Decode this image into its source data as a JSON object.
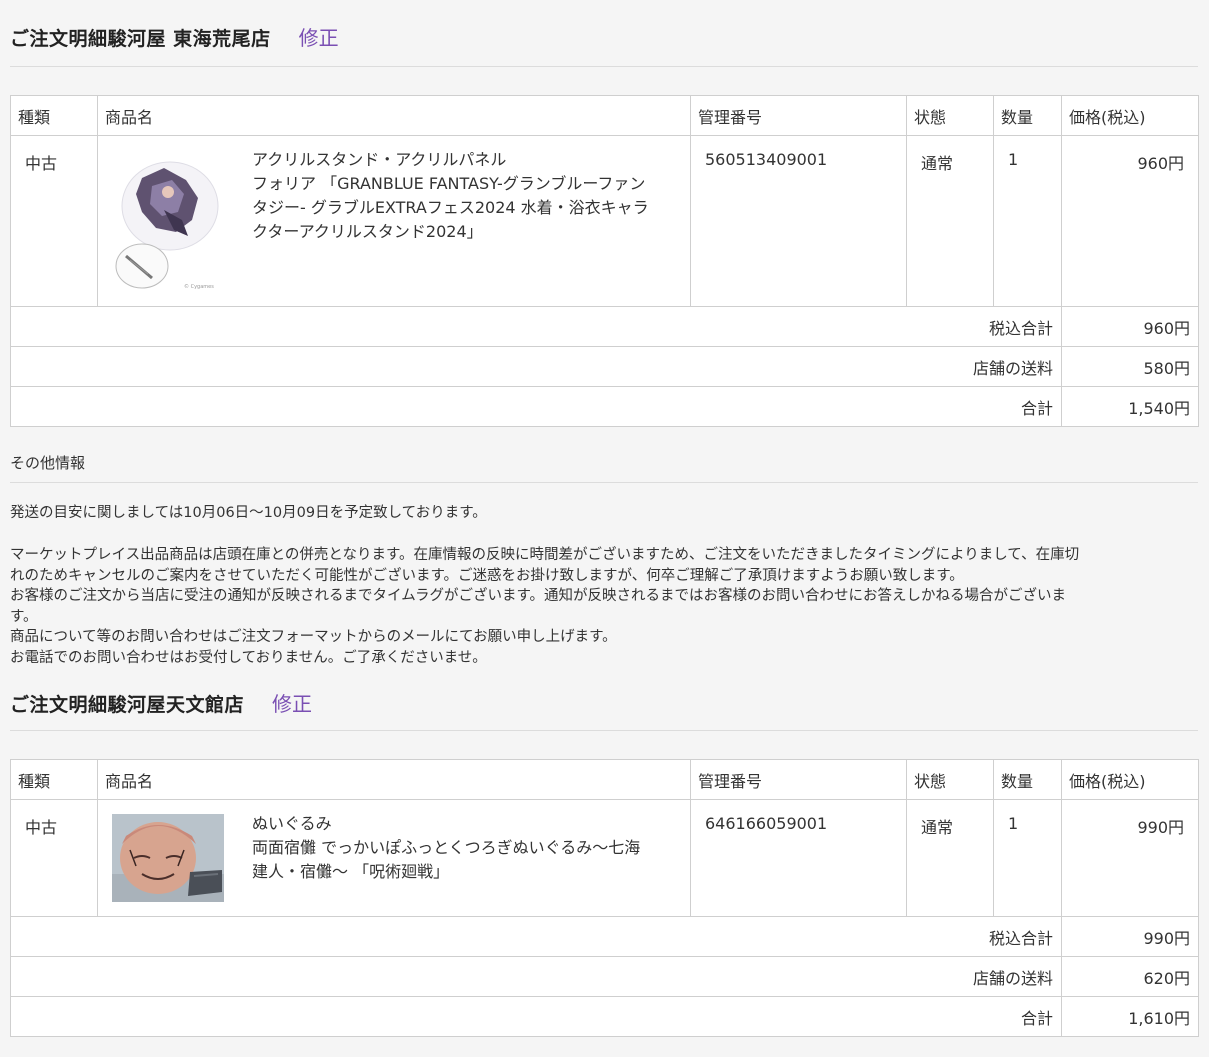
{
  "order1": {
    "title": "ご注文明細駿河屋 東海荒尾店",
    "edit_label": "修正",
    "headers": [
      "種類",
      "商品名",
      "管理番号",
      "状態",
      "数量",
      "価格(税込)"
    ],
    "item": {
      "type": "中古",
      "name_lines": [
        "アクリルスタンド・アクリルパネル",
        "フォリア 「GRANBLUE FANTASY-グランブルーファン",
        "タジー- グラブルEXTRAフェス2024 水着・浴衣キャラ",
        "クターアクリルスタンド2024」"
      ],
      "code": "560513409001",
      "condition": "通常",
      "qty": "1",
      "price": "960円"
    },
    "subtotal_label": "税込合計",
    "subtotal": "960円",
    "shipping_label": "店舗の送料",
    "shipping": "580円",
    "total_label": "合計",
    "total": "1,540円"
  },
  "other_info": {
    "title": "その他情報",
    "shipping_notice": "発送の目安に関しましては10月06日～10月09日を予定致しております。",
    "notice_lines": [
      "マーケットプレイス出品商品は店頭在庫との併売となります。在庫情報の反映に時間差がございますため、ご注文をいただきましたタイミングによりまして、在庫切",
      "れのためキャンセルのご案内をさせていただく可能性がございます。ご迷惑をお掛け致しますが、何卒ご理解ご了承頂けますようお願い致します。",
      "お客様のご注文から当店に受注の通知が反映されるまでタイムラグがございます。通知が反映されるまではお客様のお問い合わせにお答えしかねる場合がございま",
      "す。",
      "商品について等のお問い合わせはご注文フォーマットからのメールにてお願い申し上げます。",
      "お電話でのお問い合わせはお受付しておりません。ご了承くださいませ。"
    ]
  },
  "order2": {
    "title": "ご注文明細駿河屋天文館店",
    "edit_label": "修正",
    "headers": [
      "種類",
      "商品名",
      "管理番号",
      "状態",
      "数量",
      "価格(税込)"
    ],
    "item": {
      "type": "中古",
      "name_lines": [
        "ぬいぐるみ",
        "両面宿儺 でっかいぽふっとくつろぎぬいぐるみ～七海",
        "建人・宿儺～ 「呪術廻戦」"
      ],
      "code": "646166059001",
      "condition": "通常",
      "qty": "1",
      "price": "990円"
    },
    "subtotal_label": "税込合計",
    "subtotal": "990円",
    "shipping_label": "店舗の送料",
    "shipping": "620円",
    "total_label": "合計",
    "total": "1,610円"
  },
  "colors": {
    "accent_link": "#7a4fb3",
    "border": "#cfcfcf",
    "background": "#f5f5f5"
  }
}
